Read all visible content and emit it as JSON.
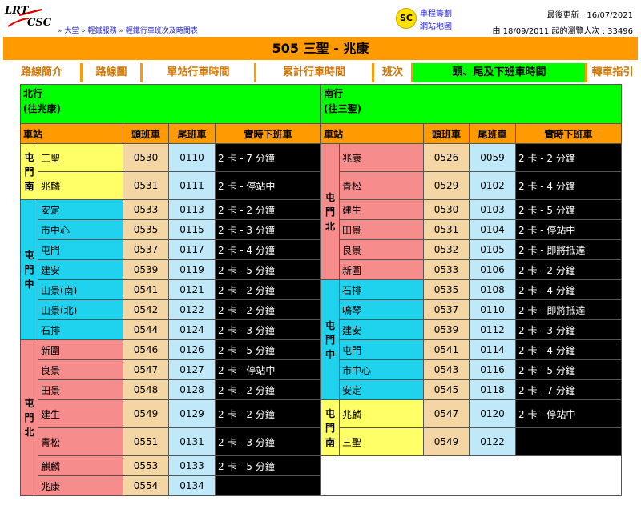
{
  "header": {
    "logo_top": "LRT",
    "logo_bottom": "CSC",
    "breadcrumb": [
      "大堂",
      "輕鐵服務",
      "輕鐵行車班次及時間表"
    ],
    "sc_badge": "SC",
    "sc_links": [
      "車程籌劃",
      "網站地圖"
    ],
    "last_update": "最後更新 : 16/07/2021",
    "visits": "由 18/09/2011 起的瀏覽人次 : 33496"
  },
  "title": "505 三聖 - 兆康",
  "tabs": [
    {
      "label": "路線簡介",
      "active": false
    },
    {
      "label": "路線圖",
      "active": false
    },
    {
      "label": "單站行車時間",
      "active": false
    },
    {
      "label": "累計行車時間",
      "active": false
    },
    {
      "label": "班次",
      "active": false
    },
    {
      "label": "頭、尾及下班車時間",
      "active": true
    },
    {
      "label": "轉車指引",
      "active": false
    }
  ],
  "north": {
    "direction": "北行",
    "destination": "(往兆康)",
    "headers": {
      "station": "車站",
      "first": "頭班車",
      "last": "尾班車",
      "realtime": "實時下班車"
    },
    "zones": [
      {
        "name": "屯門南",
        "chars": [
          "屯",
          "門",
          "南"
        ],
        "color": "#ffff66",
        "rows": [
          {
            "station": "三聖",
            "first": "0530",
            "last": "0110",
            "realtime": "2 卡 - 7 分鐘"
          },
          {
            "station": "兆麟",
            "first": "0531",
            "last": "0111",
            "realtime": "2 卡 - 停站中"
          }
        ]
      },
      {
        "name": "屯門中",
        "chars": [
          "屯",
          "門",
          "中"
        ],
        "color": "#1fd3ee",
        "rows": [
          {
            "station": "安定",
            "first": "0533",
            "last": "0113",
            "realtime": "2 卡 - 2 分鐘"
          },
          {
            "station": "市中心",
            "first": "0535",
            "last": "0115",
            "realtime": "2 卡 - 3 分鐘"
          },
          {
            "station": "屯門",
            "first": "0537",
            "last": "0117",
            "realtime": "2 卡 - 4 分鐘"
          },
          {
            "station": "建安",
            "first": "0539",
            "last": "0119",
            "realtime": "2 卡 - 5 分鐘"
          },
          {
            "station": "山景(南)",
            "first": "0541",
            "last": "0121",
            "realtime": "2 卡 - 2 分鐘"
          },
          {
            "station": "山景(北)",
            "first": "0542",
            "last": "0122",
            "realtime": "2 卡 - 2 分鐘"
          },
          {
            "station": "石排",
            "first": "0544",
            "last": "0124",
            "realtime": "2 卡 - 3 分鐘"
          }
        ]
      },
      {
        "name": "屯門北",
        "chars": [
          "屯",
          "門",
          "北"
        ],
        "color": "#f78c8c",
        "rows": [
          {
            "station": "新圍",
            "first": "0546",
            "last": "0126",
            "realtime": "2 卡 - 5 分鐘"
          },
          {
            "station": "良景",
            "first": "0547",
            "last": "0127",
            "realtime": "2 卡 - 停站中"
          },
          {
            "station": "田景",
            "first": "0548",
            "last": "0128",
            "realtime": "2 卡 - 2 分鐘"
          },
          {
            "station": "建生",
            "first": "0549",
            "last": "0129",
            "realtime": "2 卡 - 2 分鐘"
          },
          {
            "station": "青松",
            "first": "0551",
            "last": "0131",
            "realtime": "2 卡 - 3 分鐘"
          },
          {
            "station": "麒麟",
            "first": "0553",
            "last": "0133",
            "realtime": "2 卡 - 5 分鐘"
          },
          {
            "station": "兆康",
            "first": "0554",
            "last": "0134",
            "realtime": ""
          }
        ]
      }
    ]
  },
  "south": {
    "direction": "南行",
    "destination": "(往三聖)",
    "headers": {
      "station": "車站",
      "first": "頭班車",
      "last": "尾班車",
      "realtime": "實時下班車"
    },
    "zones": [
      {
        "name": "屯門北",
        "chars": [
          "屯",
          "門",
          "北"
        ],
        "color": "#f78c8c",
        "rows": [
          {
            "station": "兆康",
            "first": "0526",
            "last": "0059",
            "realtime": "2 卡 - 2 分鐘"
          },
          {
            "station": "青松",
            "first": "0529",
            "last": "0102",
            "realtime": "2 卡 - 4 分鐘"
          },
          {
            "station": "建生",
            "first": "0530",
            "last": "0103",
            "realtime": "2 卡 - 5 分鐘"
          },
          {
            "station": "田景",
            "first": "0531",
            "last": "0104",
            "realtime": "2 卡 - 停站中"
          },
          {
            "station": "良景",
            "first": "0532",
            "last": "0105",
            "realtime": "2 卡 - 即將抵達"
          },
          {
            "station": "新圍",
            "first": "0533",
            "last": "0106",
            "realtime": "2 卡 - 2 分鐘"
          }
        ]
      },
      {
        "name": "屯門中",
        "chars": [
          "屯",
          "門",
          "中"
        ],
        "color": "#1fd3ee",
        "rows": [
          {
            "station": "石排",
            "first": "0535",
            "last": "0108",
            "realtime": "2 卡 - 4 分鐘"
          },
          {
            "station": "鳴琴",
            "first": "0537",
            "last": "0110",
            "realtime": "2 卡 - 即將抵達"
          },
          {
            "station": "建安",
            "first": "0539",
            "last": "0112",
            "realtime": "2 卡 - 3 分鐘"
          },
          {
            "station": "屯門",
            "first": "0541",
            "last": "0114",
            "realtime": "2 卡 - 4 分鐘"
          },
          {
            "station": "市中心",
            "first": "0543",
            "last": "0116",
            "realtime": "2 卡 - 5 分鐘"
          },
          {
            "station": "安定",
            "first": "0545",
            "last": "0118",
            "realtime": "2 卡 - 7 分鐘"
          }
        ]
      },
      {
        "name": "屯門南",
        "chars": [
          "屯",
          "門",
          "南"
        ],
        "color": "#ffff66",
        "rows": [
          {
            "station": "兆麟",
            "first": "0547",
            "last": "0120",
            "realtime": "2 卡 - 停站中"
          },
          {
            "station": "三聖",
            "first": "0549",
            "last": "0122",
            "realtime": ""
          }
        ]
      }
    ]
  }
}
